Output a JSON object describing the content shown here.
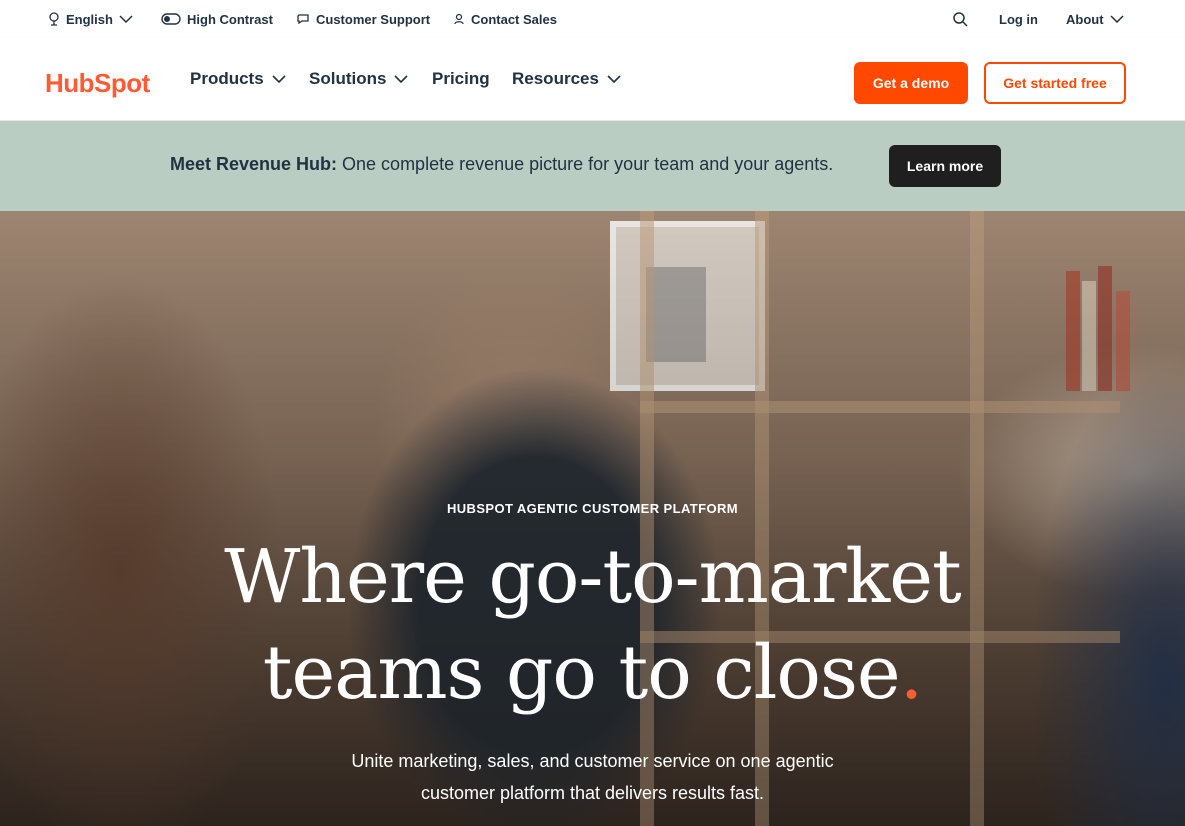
{
  "utility": {
    "language": "English",
    "high_contrast": "High Contrast",
    "customer_support": "Customer Support",
    "contact_sales": "Contact Sales",
    "log_in": "Log in",
    "about": "About"
  },
  "nav": {
    "logo": "HubSpot",
    "items": [
      {
        "label": "Products",
        "has_dropdown": true
      },
      {
        "label": "Solutions",
        "has_dropdown": true
      },
      {
        "label": "Pricing",
        "has_dropdown": false
      },
      {
        "label": "Resources",
        "has_dropdown": true
      }
    ],
    "demo_button": "Get a demo",
    "free_button": "Get started free"
  },
  "banner": {
    "bold": "Meet Revenue Hub:",
    "text": " One complete revenue picture for your team and your agents.",
    "button": "Learn more"
  },
  "hero": {
    "eyebrow": "HUBSPOT AGENTIC CUSTOMER PLATFORM",
    "headline_line1": "Where go-to-market",
    "headline_line2": "teams go to close",
    "headline_dot": ".",
    "sub_line1": "Unite marketing, sales, and customer service on one agentic",
    "sub_line2": "customer platform that delivers results fast."
  },
  "colors": {
    "brand_orange": "#ff4800",
    "banner_bg": "#b9cdc2",
    "text_dark": "#213343"
  }
}
